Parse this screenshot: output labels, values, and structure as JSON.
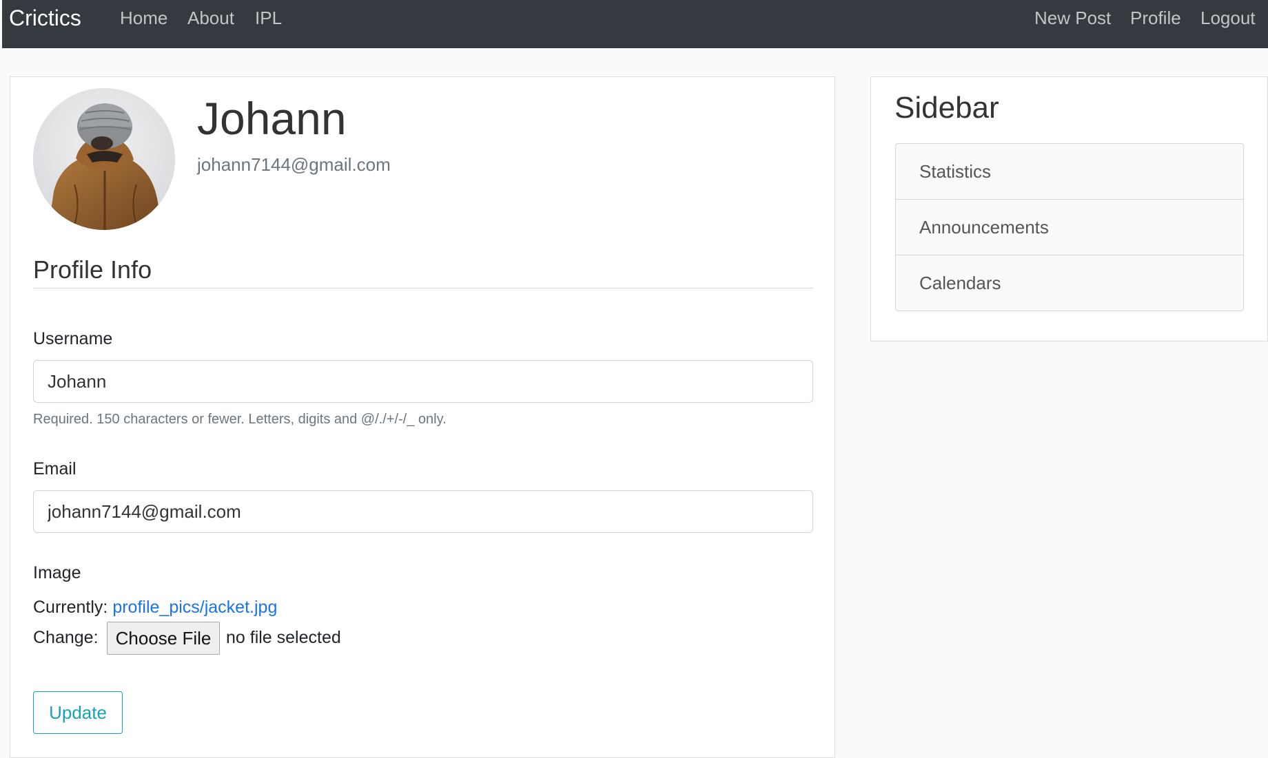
{
  "navbar": {
    "brand": "Crictics",
    "left_links": [
      "Home",
      "About",
      "IPL"
    ],
    "right_links": [
      "New Post",
      "Profile",
      "Logout"
    ]
  },
  "profile": {
    "name": "Johann",
    "email": "johann7144@gmail.com"
  },
  "form": {
    "section_title": "Profile Info",
    "username_label": "Username",
    "username_value": "Johann",
    "username_help": "Required. 150 characters or fewer. Letters, digits and @/./+/-/_ only.",
    "email_label": "Email",
    "email_value": "johann7144@gmail.com",
    "image_label": "Image",
    "currently_label": "Currently:",
    "current_file": "profile_pics/jacket.jpg",
    "change_label": "Change:",
    "choose_file_button": "Choose File",
    "no_file_text": "no file selected",
    "update_button": "Update"
  },
  "sidebar": {
    "title": "Sidebar",
    "items": [
      "Statistics",
      "Announcements",
      "Calendars"
    ]
  },
  "colors": {
    "navbar_bg": "#343a40",
    "link_blue": "#1a73e8",
    "update_teal": "#17a2b8"
  },
  "icons": {
    "avatar": "person-in-beanie-and-brown-jacket-photo"
  }
}
